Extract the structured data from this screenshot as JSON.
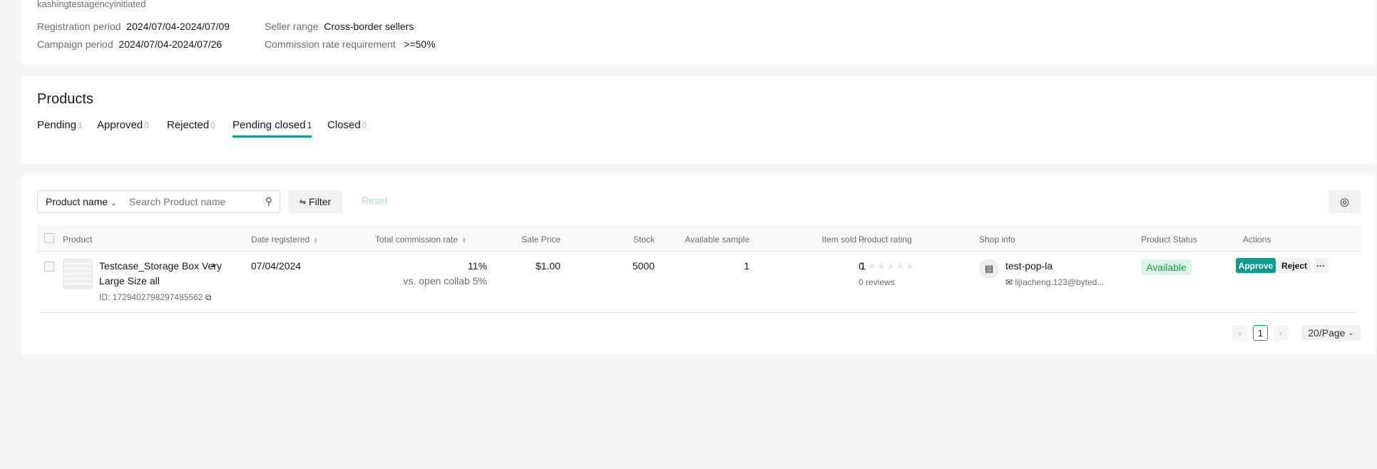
{
  "campaign": {
    "name": "kashingtestagencyinitiated",
    "registration_label": "Registration period",
    "registration_value": "2024/07/04-2024/07/09",
    "campaign_label": "Campaign period",
    "campaign_value": "2024/07/04-2024/07/26",
    "seller_label": "Seller range",
    "seller_value": "Cross-border sellers",
    "commission_label": "Commission rate requirement",
    "commission_value": ">=50%"
  },
  "products": {
    "title": "Products",
    "tabs": [
      {
        "label": "Pending",
        "count": "1"
      },
      {
        "label": "Approved",
        "count": "0"
      },
      {
        "label": "Rejected",
        "count": "0"
      },
      {
        "label": "Pending closed",
        "count": "1",
        "active": true
      },
      {
        "label": "Closed",
        "count": "0"
      }
    ]
  },
  "toolbar": {
    "search_type": "Product name",
    "search_placeholder": "Search Product name",
    "filter_label": "Filter",
    "reset_label": "Reset"
  },
  "table": {
    "columns": [
      "Product",
      "Date registered",
      "Total commission rate",
      "Sale Price",
      "Stock",
      "Available sample",
      "Item sold",
      "Product rating",
      "Shop info",
      "Product Status",
      "Actions"
    ],
    "rows": [
      {
        "name_line1": "Testcase_Storage Box Very",
        "name_line2": "Large Size all",
        "id": "ID: 1729402798297485562",
        "date": "07/04/2024",
        "commission": "11%",
        "commission_sub": "vs. open collab 5%",
        "price": "$1.00",
        "stock": "5000",
        "sample": "1",
        "sold": "1",
        "rating": "0",
        "rating_stars": 0,
        "reviews": "0 reviews",
        "shop": "test-pop-la",
        "email": "lijiacheng.123@byted...",
        "status": "Available",
        "approve": "Approve",
        "reject": "Reject",
        "more": "···"
      }
    ]
  },
  "pagination": {
    "page": "1",
    "page_size": "20/Page"
  },
  "colors": {
    "accent": "#0f9b8e",
    "status_bg": "#dcf5e6",
    "status_text": "#10a34a"
  }
}
